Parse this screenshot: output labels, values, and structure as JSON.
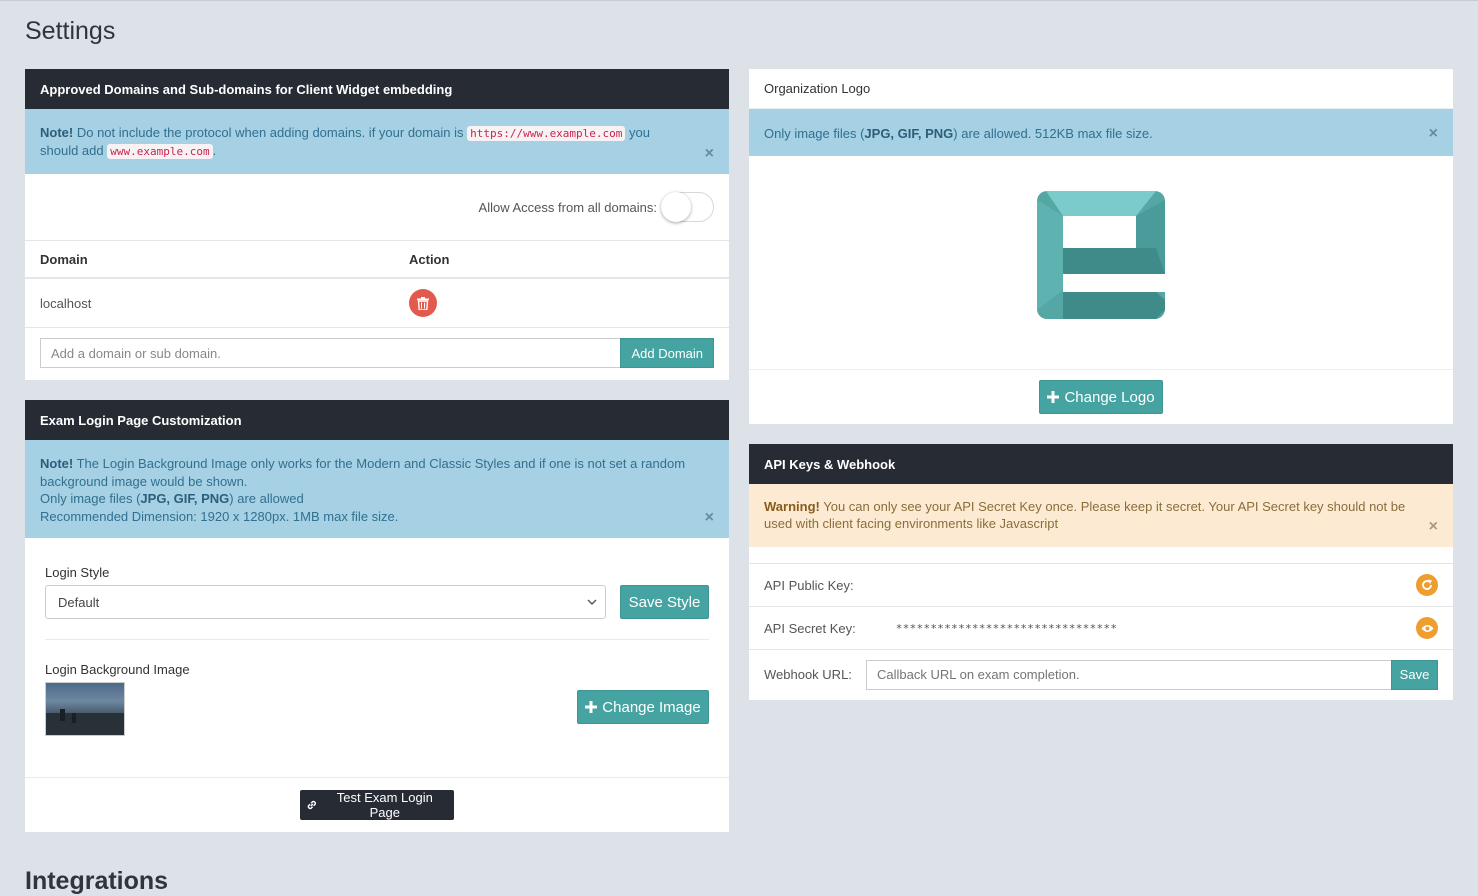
{
  "page": {
    "title": "Settings",
    "next_section_title": "Integrations"
  },
  "domains_panel": {
    "title": "Approved Domains and Sub-domains for Client Widget embedding",
    "note_strong": "Note!",
    "note_text_1": "Do not include the protocol when adding domains. if your domain is",
    "note_code_1": "https://www.example.com",
    "note_text_2": "you should add",
    "note_code_2": "www.example.com",
    "note_text_3": ".",
    "close": "×",
    "allow_label": "Allow Access from all domains:",
    "allow_all_enabled": false,
    "columns": [
      "Domain",
      "Action"
    ],
    "rows": [
      {
        "domain": "localhost"
      }
    ],
    "input_placeholder": "Add a domain or sub domain.",
    "add_button": "Add Domain"
  },
  "exam_panel": {
    "title": "Exam Login Page Customization",
    "note_strong": "Note!",
    "note_line_1": "The Login Background Image only works for the Modern and Classic Styles and if one is not set a random background image would be shown.",
    "note_line_2_pre": "Only image files (",
    "note_line_2_types": "JPG, GIF, PNG",
    "note_line_2_post": ") are allowed",
    "note_line_3": "Recommended Dimension: 1920 x 1280px. 1MB max file size.",
    "close": "×",
    "login_style_label": "Login Style",
    "login_style_value": "Default",
    "save_style_button": "Save Style",
    "bg_image_label": "Login Background Image",
    "change_image_button": "Change Image",
    "test_button": "Test Exam Login Page"
  },
  "logo_panel": {
    "title": "Organization Logo",
    "info_pre": "Only image files (",
    "info_types": "JPG, GIF, PNG",
    "info_post": ") are allowed. 512KB max file size.",
    "close": "×",
    "change_logo_button": "Change Logo",
    "colors": {
      "teal_light": "#7acbca",
      "teal_mid": "#55a7a5",
      "teal_dark": "#3f8b89"
    }
  },
  "api_panel": {
    "title": "API Keys & Webhook",
    "warning_strong": "Warning!",
    "warning_text": "You can only see your API Secret Key once. Please keep it secret. Your API Secret key should not be used with client facing environments like Javascript",
    "close": "×",
    "public_key_label": "API Public Key:",
    "public_key_value": "",
    "secret_key_label": "API Secret Key:",
    "secret_key_value": "********************************",
    "webhook_label": "Webhook URL:",
    "webhook_placeholder": "Callback URL on exam completion.",
    "save_button": "Save"
  },
  "icons": {
    "refresh": "refresh-icon",
    "eye": "eye-icon",
    "trash": "trash-icon",
    "plus": "plus-icon",
    "link": "link-icon",
    "chevron": "chevron-down-icon"
  }
}
